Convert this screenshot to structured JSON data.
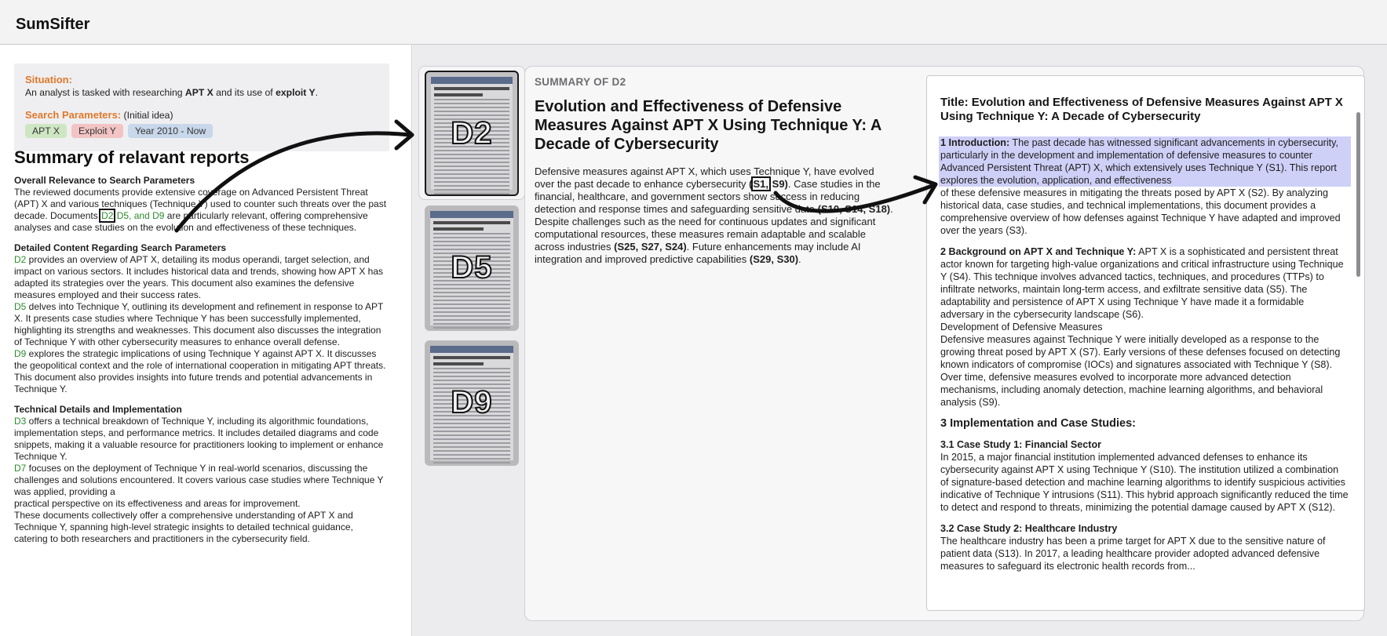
{
  "app": {
    "title": "SumSifter"
  },
  "situation": {
    "label": "Situation:",
    "text_pre": "An analyst is tasked with researching ",
    "text_bold1": "APT X",
    "text_mid": " and its use of ",
    "text_bold2": "exploit Y",
    "text_post": "."
  },
  "search_params": {
    "label": "Search Parameters:",
    "note": " (Initial idea)",
    "chips": [
      "APT X",
      "Exploit Y",
      "Year 2010 - Now"
    ]
  },
  "summary": {
    "heading": "Summary of relavant reports",
    "s1_title": "Overall Relevance to Search Parameters",
    "s1_text_a": "The reviewed documents provide extensive coverage on Advanced Persistent Threat (APT) X and various techniques (Technique Y) used to counter such threats over the past decade. Documents ",
    "s1_ref_d2": "D2",
    "s1_ref_rest": " D5, and D9",
    "s1_text_b": " are particularly relevant, offering comprehensive analyses and case studies on the evolution and effectiveness of these techniques.",
    "s2_title": "Detailed Content Regarding Search Parameters",
    "d2_ref": "D2",
    "d2_text": " provides an overview of APT X, detailing its modus operandi, target selection, and impact on various sectors. It includes historical data and trends, showing how APT X has adapted its strategies over the years. This document also examines the defensive measures employed and their success rates.",
    "d5_ref": "D5",
    "d5_text": " delves into Technique Y, outlining its development and refinement in response to APT X. It presents case studies where Technique Y has been successfully implemented, highlighting its strengths and weaknesses. This document also discusses the integration of Technique Y with other cybersecurity measures to enhance overall defense.",
    "d9_ref": "D9",
    "d9_text": " explores the strategic implications of using Technique Y against APT X. It discusses the geopolitical context and the role of international cooperation in mitigating APT threats. This document also provides insights into future trends and potential advancements in Technique Y.",
    "s3_title": "Technical Details and Implementation",
    "d3_ref": "D3",
    "d3_text": " offers a technical breakdown of Technique Y, including its algorithmic foundations, implementation steps, and performance metrics. It includes detailed diagrams and code snippets, making it a valuable resource for practitioners looking to implement or enhance Technique Y.",
    "d7_ref": "D7",
    "d7_text": " focuses on the deployment of Technique Y in real-world scenarios, discussing the challenges and solutions encountered. It covers various case studies where Technique Y was applied, providing a",
    "d7_text2": "practical perspective on its effectiveness and areas for improvement.",
    "closing": "These documents collectively offer a comprehensive understanding of APT X and Technique Y, spanning high-level strategic insights to detailed technical guidance, catering to both researchers and practitioners in the cybersecurity field."
  },
  "thumbnails": [
    {
      "label": "D2",
      "selected": true,
      "page_heading": "Epigenic effects of betaine supplementation on strength and power performance"
    },
    {
      "label": "D5",
      "selected": false,
      "page_heading": "Epigenic effects of betaine supplementation on strength and power performance"
    },
    {
      "label": "D9",
      "selected": false,
      "page_heading": "Epigenic effects of betaine supplementation on strength and power performance"
    }
  ],
  "doc_summary": {
    "kicker": "SUMMARY OF D2",
    "title": "Evolution and Effectiveness of Defensive Measures Against APT X Using Technique Y: A Decade of Cybersecurity",
    "p_a": "Defensive measures against APT X, which uses Technique Y, have evolved over the past decade to enhance cybersecurity ",
    "cite1_open": "(",
    "cite1_boxed": "S1,",
    "cite1_rest": " S9)",
    "p_b": ". Case studies in the financial, healthcare, and government sectors show success in reducing detection and response times and safeguarding sensitive data ",
    "cite2": "(S10, S14, S18)",
    "p_c": ". Despite challenges such as the need for continuous updates and significant computational resources, these measures remain adaptable and scalable across industries ",
    "cite3": "(S25, S27, S24)",
    "p_d": ". Future enhancements may include AI integration and improved predictive capabilities ",
    "cite4": "(S29, S30)",
    "p_e": "."
  },
  "fulltext": {
    "title": "Title: Evolution and Effectiveness of Defensive Measures Against APT X Using Technique Y: A Decade of Cybersecurity",
    "intro_head": "1 Introduction:",
    "intro_hl": " The past decade has witnessed significant advancements in cybersecurity, particularly in the development and implementation of defensive measures to counter Advanced Persistent Threat (APT) X, which extensively uses Technique Y (S1). This report explores the evolution, application, and effectiveness",
    "intro_rest": "of these defensive measures in mitigating the threats posed by APT X (S2). By analyzing historical data, case studies, and technical implementations, this document provides a comprehensive overview of how defenses against Technique Y have adapted and improved over the years (S3).",
    "bg_head": "2 Background on APT X and Technique Y:",
    "bg_text": " APT X is a sophisticated and persistent threat actor known for targeting high-value organizations and critical infrastructure using Technique Y (S4). This technique involves advanced tactics, techniques, and procedures (TTPs) to infiltrate networks, maintain long-term access, and exfiltrate sensitive data (S5). The adaptability and persistence of APT X using Technique Y have made it a formidable adversary in the cybersecurity landscape (S6).",
    "dev_line": "Development of Defensive Measures",
    "dev_text": "Defensive measures against Technique Y were initially developed as a response to the growing threat posed by APT X (S7). Early versions of these defenses focused on detecting known indicators of compromise (IOCs) and signatures associated with Technique Y (S8). Over time, defensive measures evolved to incorporate more advanced detection mechanisms, including anomaly detection, machine learning algorithms, and behavioral analysis (S9).",
    "impl_head": "3 Implementation and Case Studies:",
    "cs1_head": "3.1 Case Study 1: Financial Sector",
    "cs1_text": "In 2015, a major financial institution implemented advanced defenses to enhance its cybersecurity against APT X using Technique Y (S10). The institution utilized a combination of signature-based detection and machine learning algorithms to identify suspicious activities indicative of Technique Y intrusions (S11). This hybrid approach significantly reduced the time to detect and respond to threats, minimizing the potential damage caused by APT X (S12).",
    "cs2_head": "3.2 Case Study 2: Healthcare Industry",
    "cs2_text": "The healthcare industry has been a prime target for APT X due to the sensitive nature of patient data (S13). In 2017, a leading healthcare provider adopted advanced defensive measures to safeguard its electronic health records from..."
  }
}
